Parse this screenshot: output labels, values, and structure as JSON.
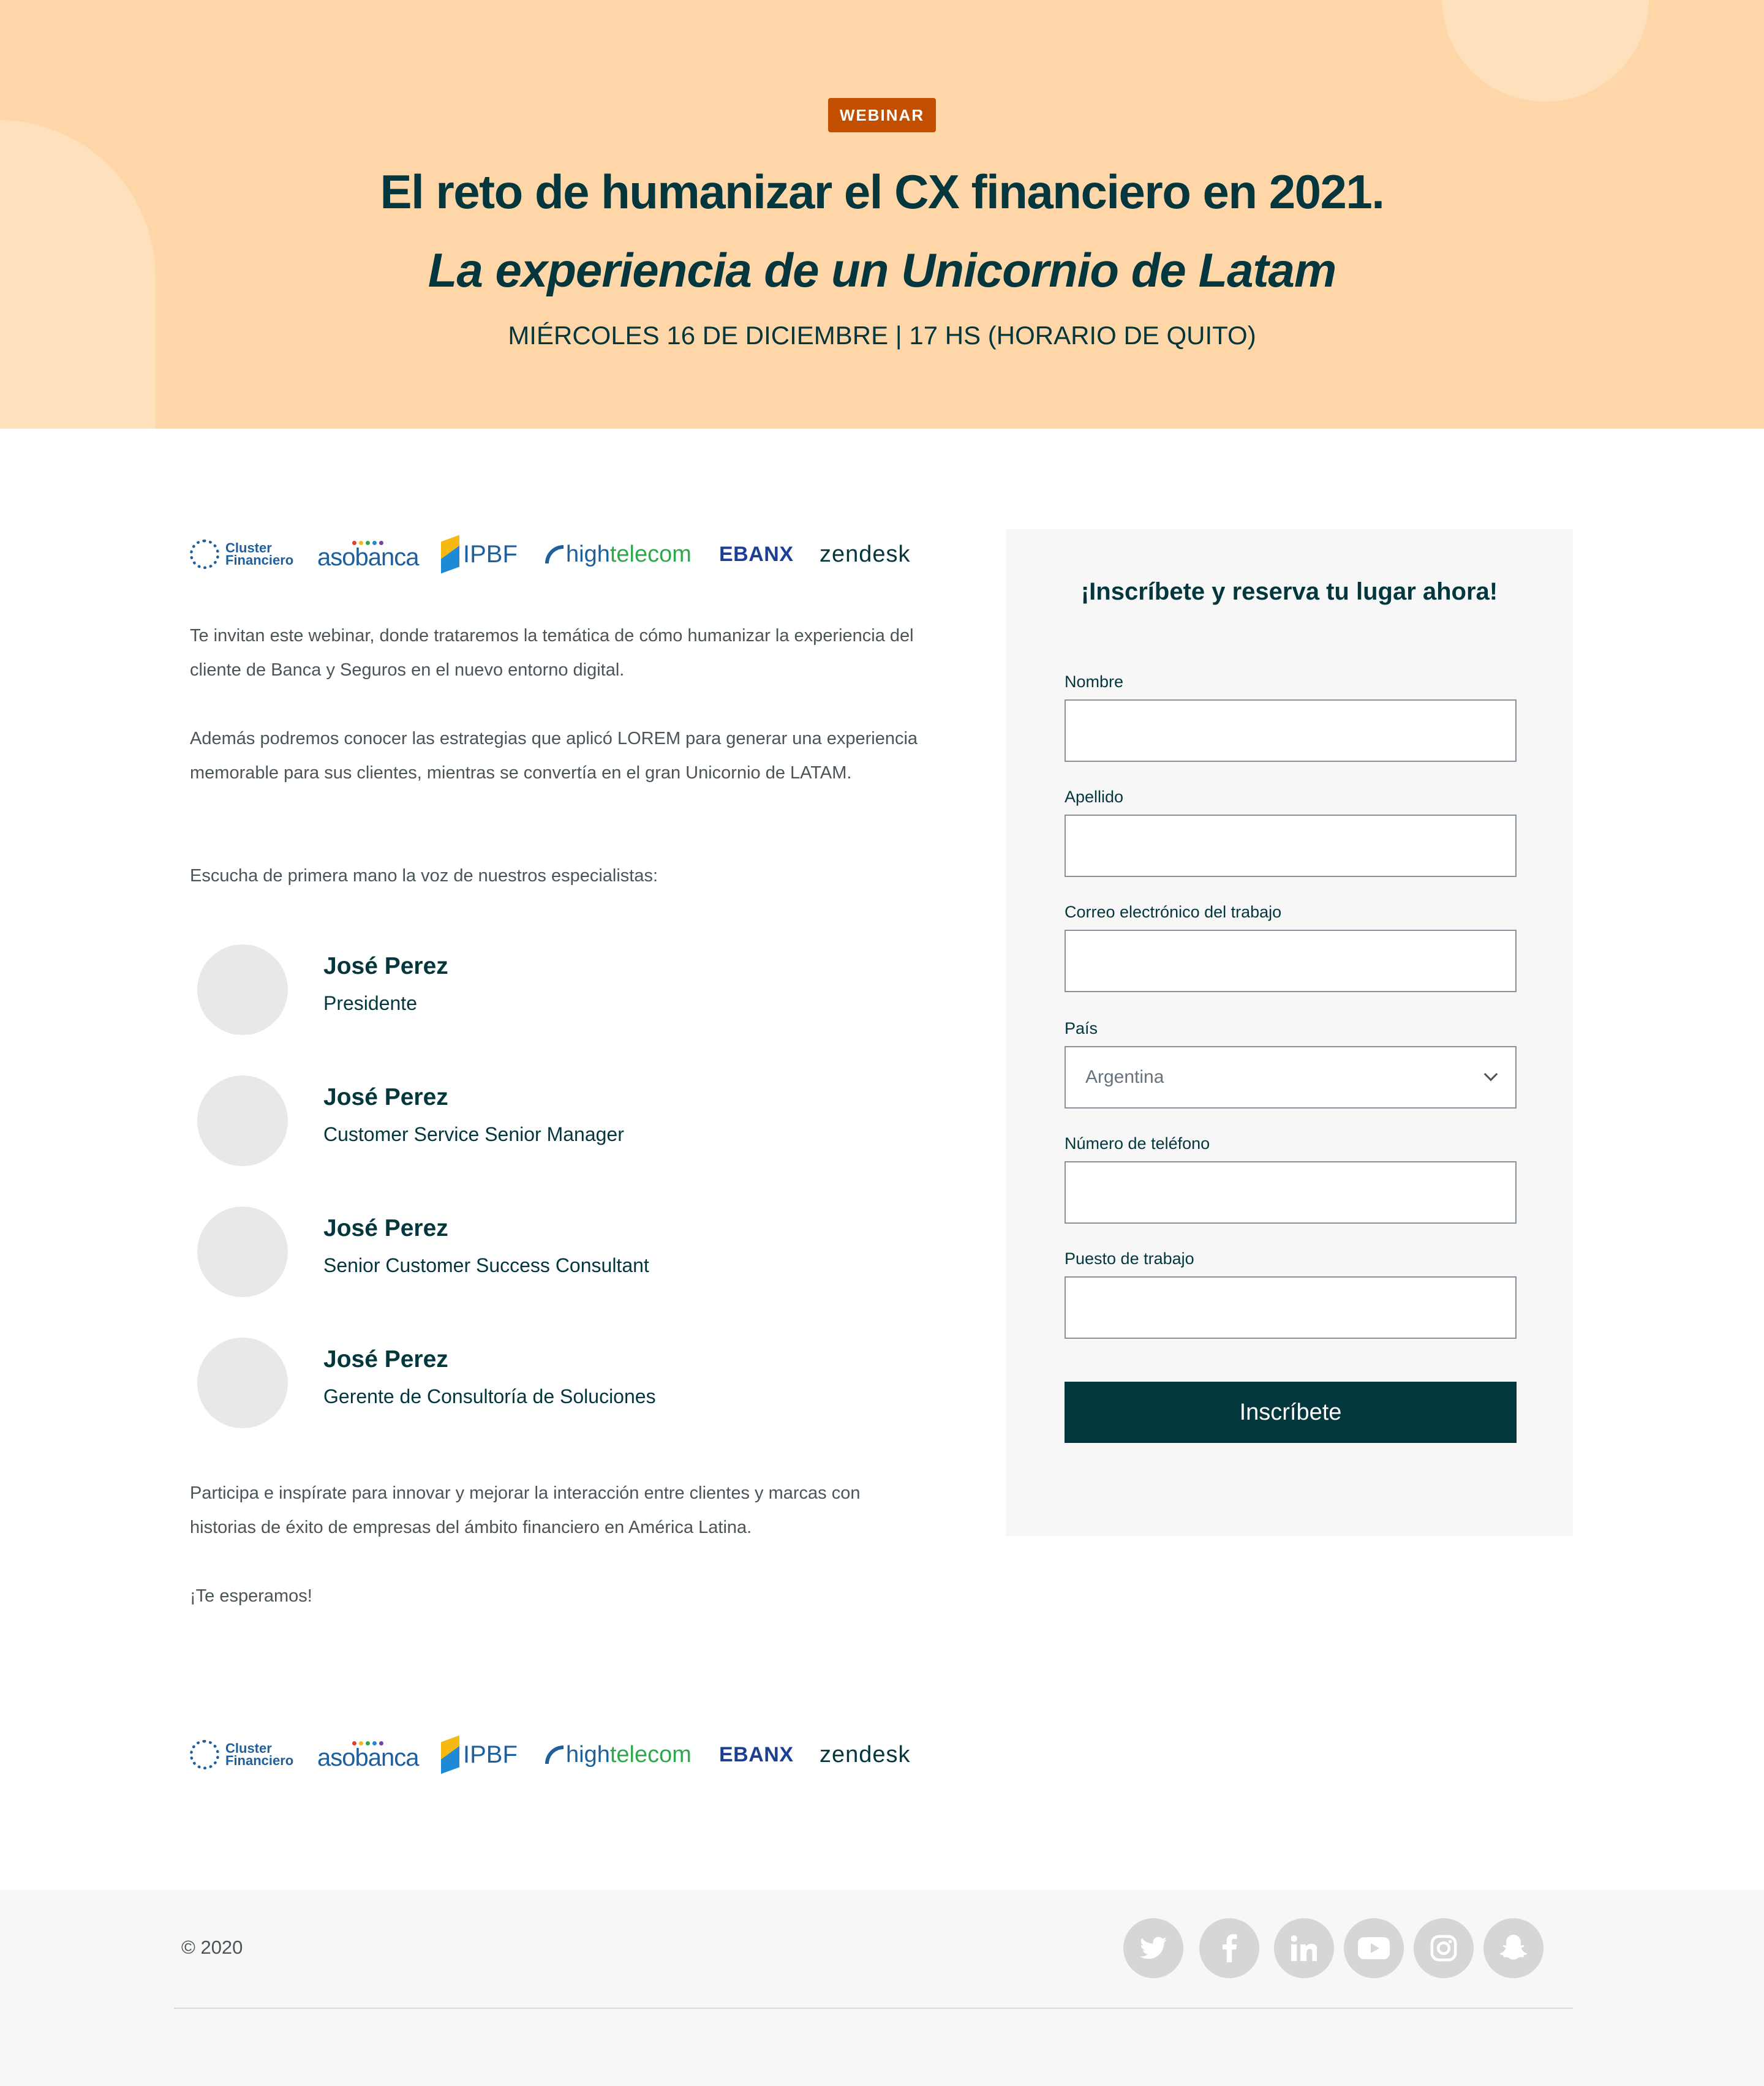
{
  "hero": {
    "badge": "WEBINAR",
    "title": "El reto de humanizar el CX financiero en 2021.",
    "subtitle": "La experiencia de un Unicornio de Latam",
    "date": "MIÉRCOLES 16 DE DICIEMBRE | 17 HS (HORARIO DE QUITO)"
  },
  "logos": {
    "cluster": [
      "Cluster",
      "Financiero"
    ],
    "asobanca": "asobanca",
    "ipbf": "IPBF",
    "hightelecom": [
      "high",
      "telecom"
    ],
    "ebanx": "EBANX",
    "zendesk": "zendesk"
  },
  "content": {
    "p1": "Te invitan este webinar, donde trataremos la temática de cómo humanizar la experiencia del cliente de Banca y Seguros en el nuevo entorno digital.",
    "p2": "Además podremos conocer las estrategias que aplicó LOREM para generar una experiencia memorable para sus clientes, mientras se convertía en el gran Unicornio de LATAM.",
    "p3": "Escucha de primera mano la voz de nuestros especialistas:",
    "p4": "Participa e inspírate para innovar y mejorar la interacción entre clientes y marcas con historias de éxito de empresas del ámbito financiero en América Latina.",
    "p5": "¡Te esperamos!"
  },
  "speakers": [
    {
      "name": "José Perez",
      "role": "Presidente"
    },
    {
      "name": "José Perez",
      "role": "Customer Service Senior Manager"
    },
    {
      "name": "José Perez",
      "role": "Senior Customer Success Consultant"
    },
    {
      "name": "José Perez",
      "role": "Gerente de Consultoría de Soluciones"
    }
  ],
  "form": {
    "title": "¡Inscríbete y reserva tu lugar ahora!",
    "fields": {
      "first_name": {
        "label": "Nombre",
        "value": ""
      },
      "last_name": {
        "label": "Apellido",
        "value": ""
      },
      "email": {
        "label": "Correo electrónico del trabajo",
        "value": ""
      },
      "country": {
        "label": "País",
        "value": "Argentina"
      },
      "phone": {
        "label": "Número de teléfono",
        "value": ""
      },
      "job": {
        "label": "Puesto de trabajo",
        "value": ""
      }
    },
    "submit": "Inscríbete"
  },
  "footer": {
    "copyright": "©  2020",
    "socials": [
      "twitter-icon",
      "facebook-icon",
      "linkedin-icon",
      "youtube-icon",
      "instagram-icon",
      "snapchat-icon"
    ]
  },
  "colors": {
    "hero_bg": "#fed6a8",
    "badge_bg": "#c24f00",
    "primary": "#03363d",
    "form_bg": "#f6f7f6"
  }
}
